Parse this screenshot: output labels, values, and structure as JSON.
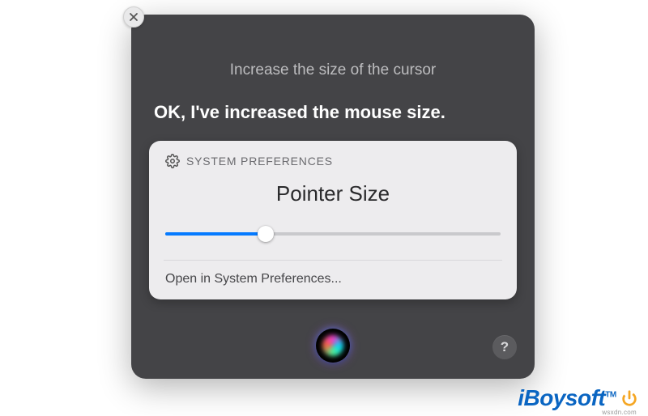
{
  "siri": {
    "prompt": "Increase the size of the cursor",
    "response": "OK, I've increased the mouse size."
  },
  "pref_card": {
    "app_label": "SYSTEM PREFERENCES",
    "title": "Pointer Size",
    "slider_value_percent": 30,
    "open_link": "Open in System Preferences..."
  },
  "help_label": "?",
  "watermark": {
    "brand": "iBoysoft",
    "tm": "TM",
    "sub": "wsxdn.com"
  }
}
